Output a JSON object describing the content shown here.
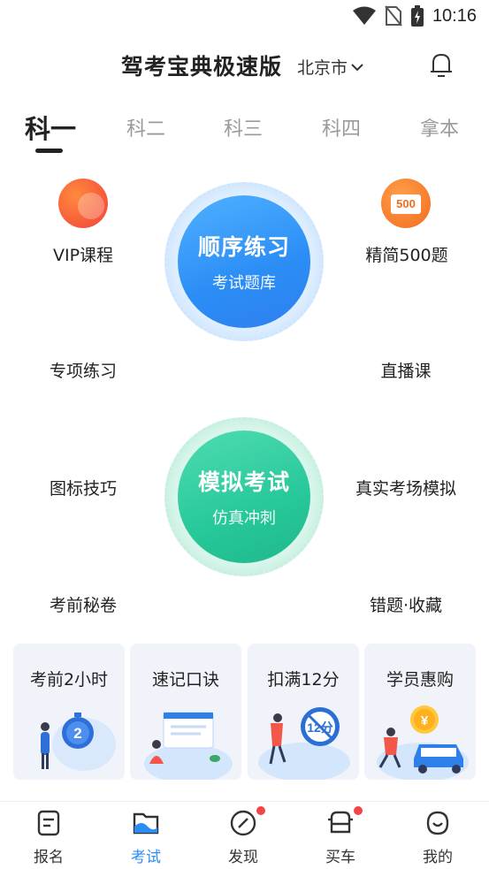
{
  "status_bar": {
    "time": "10:16",
    "icons": [
      "wifi-icon",
      "no-sim-icon",
      "battery-charging-icon"
    ]
  },
  "header": {
    "title": "驾考宝典极速版",
    "city": "北京市",
    "icons": [
      "chevron-down-icon",
      "bell-icon"
    ]
  },
  "tabs": [
    {
      "label": "科一",
      "active": true
    },
    {
      "label": "科二"
    },
    {
      "label": "科三"
    },
    {
      "label": "科四"
    },
    {
      "label": "拿本"
    }
  ],
  "grid": {
    "vip": "VIP课程",
    "jingjian": "精简500题",
    "jingjian_badge": "500",
    "special": "专项练习",
    "live": "直播课",
    "icons_tips": "图标技巧",
    "real_sim": "真实考场模拟",
    "secret": "考前秘卷",
    "wrong": "错题·收藏",
    "order": {
      "title": "顺序练习",
      "sub": "考试题库"
    },
    "mock": {
      "title": "模拟考试",
      "sub": "仿真冲刺"
    }
  },
  "cards": [
    {
      "title": "考前2小时",
      "art_text": "2"
    },
    {
      "title": "速记口诀"
    },
    {
      "title": "扣满12分",
      "art_text": "12分"
    },
    {
      "title": "学员惠购",
      "art_text": "¥"
    }
  ],
  "nav": [
    {
      "label": "报名",
      "icon": "signup-icon"
    },
    {
      "label": "考试",
      "icon": "exam-icon",
      "active": true
    },
    {
      "label": "发现",
      "icon": "discover-icon",
      "badge": true
    },
    {
      "label": "买车",
      "icon": "car-icon",
      "badge": true
    },
    {
      "label": "我的",
      "icon": "profile-icon"
    }
  ],
  "colors": {
    "accent_blue": "#2b8df5",
    "accent_green": "#27c89a",
    "badge_red": "#f24646"
  }
}
